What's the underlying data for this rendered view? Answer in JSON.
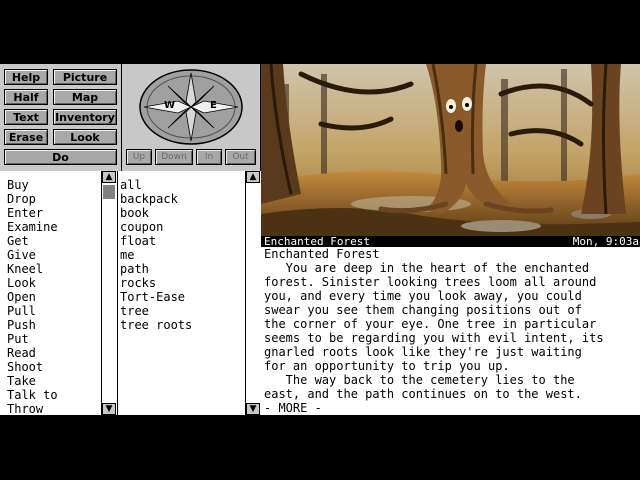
{
  "buttons": {
    "help": "Help",
    "picture": "Picture",
    "half": "Half",
    "map": "Map",
    "text": "Text",
    "inventory": "Inventory",
    "erase": "Erase",
    "look": "Look",
    "do": "Do"
  },
  "compass": {
    "west": "W",
    "east": "E",
    "up": "Up",
    "down": "Down",
    "in": "In",
    "out": "Out"
  },
  "status": {
    "location": "Enchanted Forest",
    "time": "Mon, 9:03a"
  },
  "verbs": [
    "Buy",
    "Drop",
    "Enter",
    "Examine",
    "Get",
    "Give",
    "Kneel",
    "Look",
    "Open",
    "Pull",
    "Push",
    "Put",
    "Read",
    "Shoot",
    "Take",
    "Talk to",
    "Throw"
  ],
  "nouns": [
    "all",
    "backpack",
    "book",
    "coupon",
    "float",
    "me",
    "path",
    "rocks",
    "Tort-Ease",
    "tree",
    "tree roots"
  ],
  "story": [
    "Enchanted Forest",
    "   You are deep in the heart of the enchanted",
    "forest. Sinister looking trees loom all around",
    "you, and every time you look away, you could",
    "swear you see them changing positions out of",
    "the corner of your eye. One tree in particular",
    "seems to be regarding you with evil intent, its",
    "gnarled roots look like they're just waiting",
    "for an opportunity to trip you up.",
    "   The way back to the cemetery lies to the",
    "east, and the path continues on to the west.",
    "- MORE -"
  ],
  "colors": {
    "panel": "#c8c8c8",
    "button": "#a8a8a8",
    "compass_body": "#a0a0a0"
  }
}
